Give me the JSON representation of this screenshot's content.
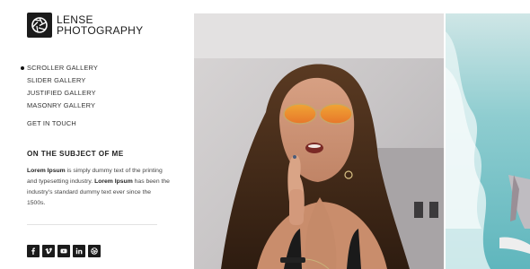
{
  "brand": {
    "line1": "LENSE",
    "line2": "PHOTOGRAPHY"
  },
  "nav": {
    "items": [
      {
        "label": "SCROLLER GALLERY",
        "active": true
      },
      {
        "label": "SLIDER GALLERY",
        "active": false
      },
      {
        "label": "JUSTIFIED GALLERY",
        "active": false
      },
      {
        "label": "MASONRY GALLERY",
        "active": false
      }
    ],
    "contact": "GET IN TOUCH"
  },
  "about": {
    "title": "ON THE SUBJECT OF ME",
    "bold1": "Lorem Ipsum",
    "text1": " is simply dummy text of the printing and typesetting industry. ",
    "bold2": "Lorem Ipsum",
    "text2": " has been the industry's standard dummy text ever since the 1500s."
  },
  "social": {
    "icons": [
      "facebook-icon",
      "vimeo-icon",
      "youtube-icon",
      "linkedin-icon",
      "dribbble-icon"
    ]
  },
  "colors": {
    "accent": "#1b1b1b",
    "text": "#333333",
    "divider": "#e2e2e2"
  }
}
